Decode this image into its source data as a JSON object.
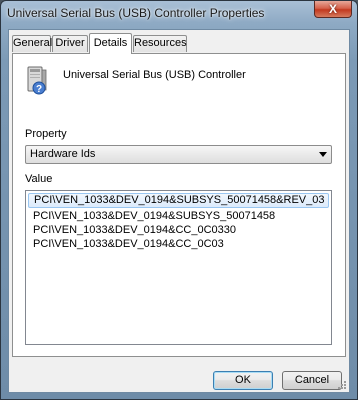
{
  "window": {
    "title": "Universal Serial Bus (USB) Controller Properties",
    "close_glyph": "X"
  },
  "tabs": [
    {
      "label": "General",
      "active": false
    },
    {
      "label": "Driver",
      "active": false
    },
    {
      "label": "Details",
      "active": true
    },
    {
      "label": "Resources",
      "active": false
    }
  ],
  "details": {
    "device_name": "Universal Serial Bus (USB) Controller",
    "device_icon": "usb-device-icon",
    "property_label": "Property",
    "property_selected": "Hardware Ids",
    "value_label": "Value",
    "values": [
      "PCI\\VEN_1033&DEV_0194&SUBSYS_50071458&REV_03",
      "PCI\\VEN_1033&DEV_0194&SUBSYS_50071458",
      "PCI\\VEN_1033&DEV_0194&CC_0C0330",
      "PCI\\VEN_1033&DEV_0194&CC_0C03"
    ],
    "selected_value_index": 0
  },
  "buttons": {
    "ok": "OK",
    "cancel": "Cancel"
  },
  "colors": {
    "selection_border": "#99c6f1",
    "title_bar": "#8eaac4"
  }
}
